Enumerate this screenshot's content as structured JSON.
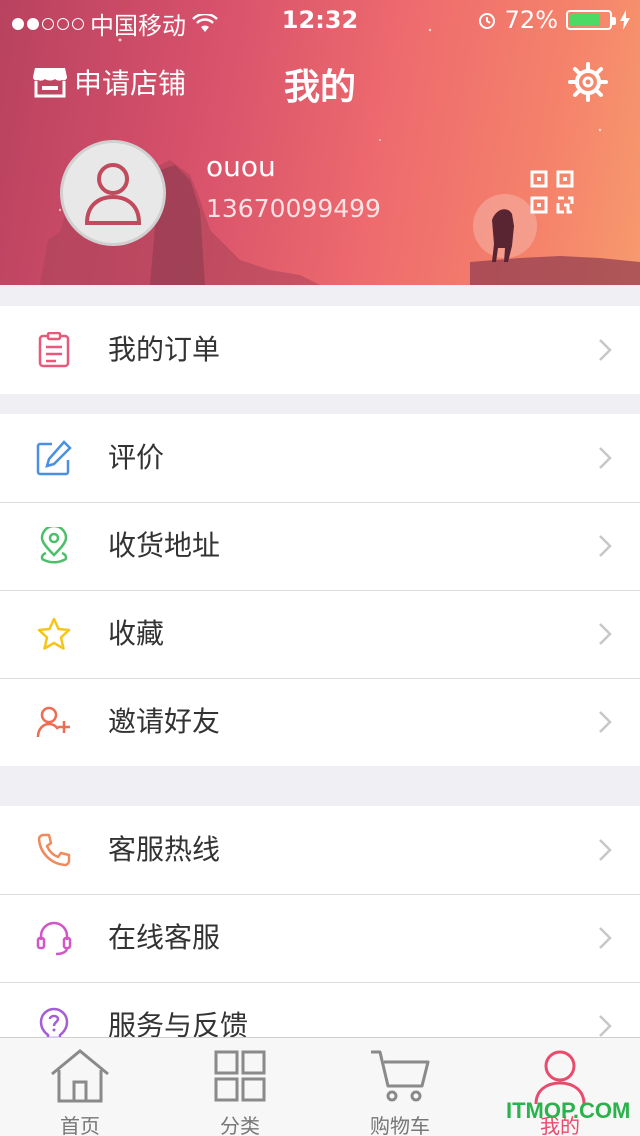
{
  "status_bar": {
    "carrier": "中国移动",
    "time": "12:32",
    "battery_percent": "72%"
  },
  "nav": {
    "apply_store_label": "申请店铺",
    "title": "我的"
  },
  "profile": {
    "username": "ouou",
    "phone": "13670099499"
  },
  "menu_groups": [
    {
      "items": [
        {
          "label": "我的订单",
          "icon": "clipboard-icon",
          "color": "#e8587a"
        }
      ]
    },
    {
      "items": [
        {
          "label": "评价",
          "icon": "edit-icon",
          "color": "#4a90e2"
        },
        {
          "label": "收货地址",
          "icon": "location-pin-icon",
          "color": "#4cbf6a"
        },
        {
          "label": "收藏",
          "icon": "star-icon",
          "color": "#f5c518"
        },
        {
          "label": "邀请好友",
          "icon": "add-friend-icon",
          "color": "#ef6b52"
        }
      ]
    },
    {
      "items": [
        {
          "label": "客服热线",
          "icon": "phone-icon",
          "color": "#f08a5d"
        },
        {
          "label": "在线客服",
          "icon": "headset-icon",
          "color": "#d455c8"
        },
        {
          "label": "服务与反馈",
          "icon": "lightbulb-question-icon",
          "color": "#a45fd6"
        }
      ]
    }
  ],
  "tabbar": {
    "tabs": [
      {
        "label": "首页",
        "icon": "home-icon"
      },
      {
        "label": "分类",
        "icon": "grid-icon"
      },
      {
        "label": "购物车",
        "icon": "cart-icon"
      },
      {
        "label": "我的",
        "icon": "user-icon",
        "active": true
      }
    ]
  },
  "watermark": "ITMOP.COM",
  "colors": {
    "header_start": "#b8425f",
    "header_end": "#f79a6e",
    "active_tab": "#e84b6c",
    "battery": "#4cd964"
  }
}
